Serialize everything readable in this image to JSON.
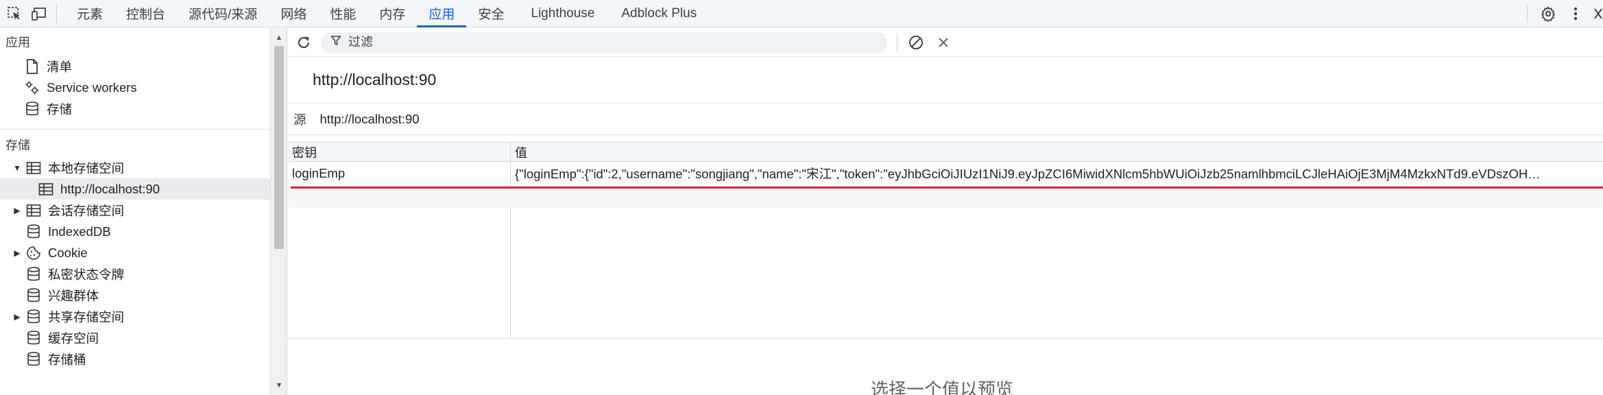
{
  "topbar": {
    "tabs": [
      {
        "label": "元素"
      },
      {
        "label": "控制台"
      },
      {
        "label": "源代码/来源"
      },
      {
        "label": "网络"
      },
      {
        "label": "性能"
      },
      {
        "label": "内存"
      },
      {
        "label": "应用",
        "active": true
      },
      {
        "label": "安全"
      },
      {
        "label": "Lighthouse"
      },
      {
        "label": "Adblock Plus"
      }
    ]
  },
  "sidebar": {
    "app_section": "应用",
    "app_items": [
      {
        "label": "清单",
        "icon": "document-icon"
      },
      {
        "label": "Service workers",
        "icon": "gears-icon"
      },
      {
        "label": "存储",
        "icon": "database-icon"
      }
    ],
    "storage_section": "存储",
    "storage_items": [
      {
        "label": "本地存储空间",
        "icon": "table-icon",
        "expanded": true
      },
      {
        "label": "http://localhost:90",
        "icon": "table-icon",
        "child": true,
        "selected": true
      },
      {
        "label": "会话存储空间",
        "icon": "table-icon",
        "collapsed": true
      },
      {
        "label": "IndexedDB",
        "icon": "database-icon"
      },
      {
        "label": "Cookie",
        "icon": "cookie-icon",
        "collapsed": true
      },
      {
        "label": "私密状态令牌",
        "icon": "database-icon"
      },
      {
        "label": "兴趣群体",
        "icon": "database-icon"
      },
      {
        "label": "共享存储空间",
        "icon": "database-icon",
        "collapsed": true
      },
      {
        "label": "缓存空间",
        "icon": "database-icon"
      },
      {
        "label": "存储桶",
        "icon": "database-icon"
      }
    ]
  },
  "toolbar": {
    "filter_placeholder": "过滤"
  },
  "main": {
    "origin_title": "http://localhost:90",
    "origin_label": "源",
    "origin_value": "http://localhost:90",
    "table": {
      "headers": {
        "key": "密钥",
        "value": "值"
      },
      "rows": [
        {
          "key": "loginEmp",
          "value": "{\"loginEmp\":{\"id\":2,\"username\":\"songjiang\",\"name\":\"宋江\",\"token\":\"eyJhbGciOiJIUzI1NiJ9.eyJpZCI6MiwidXNlcm5hbWUiOiJzb25namlhbmciLCJleHAiOjE3MjM4MzkxNTd9.eVDszOH…"
        }
      ]
    },
    "preview_text": "选择一个值以预览"
  },
  "colors": {
    "accent": "#1a5fd0",
    "highlight_line": "#d6212e"
  }
}
